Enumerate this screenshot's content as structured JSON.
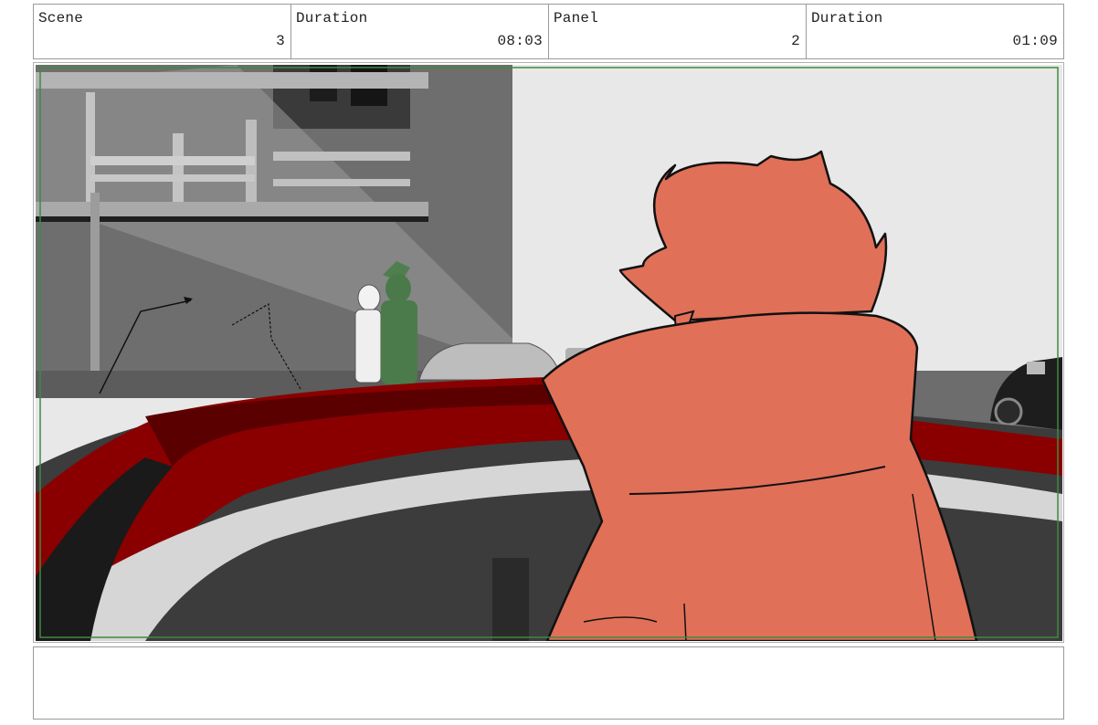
{
  "header": {
    "scene": {
      "label": "Scene",
      "value": "3"
    },
    "scene_duration": {
      "label": "Duration",
      "value": "08:03"
    },
    "panel": {
      "label": "Panel",
      "value": "2"
    },
    "panel_duration": {
      "label": "Duration",
      "value": "01:09"
    }
  },
  "panel_image": {
    "description_icon": "storyboard-panel-image",
    "safe_area_color": "#3f8a3f"
  },
  "notes": {
    "text": ""
  }
}
